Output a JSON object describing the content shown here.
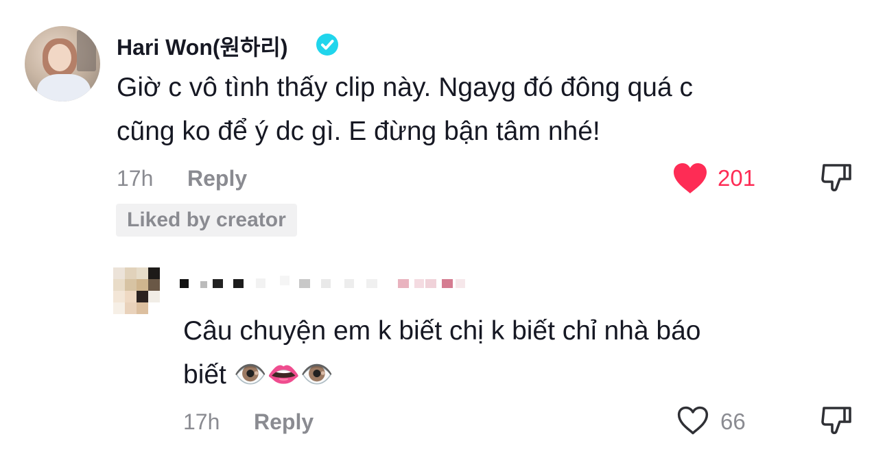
{
  "comments": [
    {
      "username": "Hari Won(원하리)",
      "verified": true,
      "text_line1": "Giờ c vô tình thấy clip này. Ngayg đó đông quá c",
      "text_line2": "cũng ko để ý dc gì. E đừng bận tâm nhé!",
      "time": "17h",
      "reply_label": "Reply",
      "liked": true,
      "likes": "201",
      "badge": "Liked by creator"
    },
    {
      "username": "",
      "username_redacted": true,
      "text_line1": "Câu chuyện em k biết chị k biết chỉ nhà báo",
      "text_line2": "biết",
      "emojis": [
        "👁️",
        "👄",
        "👁️"
      ],
      "time": "17h",
      "reply_label": "Reply",
      "liked": false,
      "likes": "66"
    }
  ],
  "colors": {
    "like_active": "#fe2c55",
    "verified": "#20d5ec",
    "muted": "#8a8b91"
  },
  "icons": [
    "verified-badge-icon",
    "heart-filled-icon",
    "heart-outline-icon",
    "dislike-icon"
  ]
}
